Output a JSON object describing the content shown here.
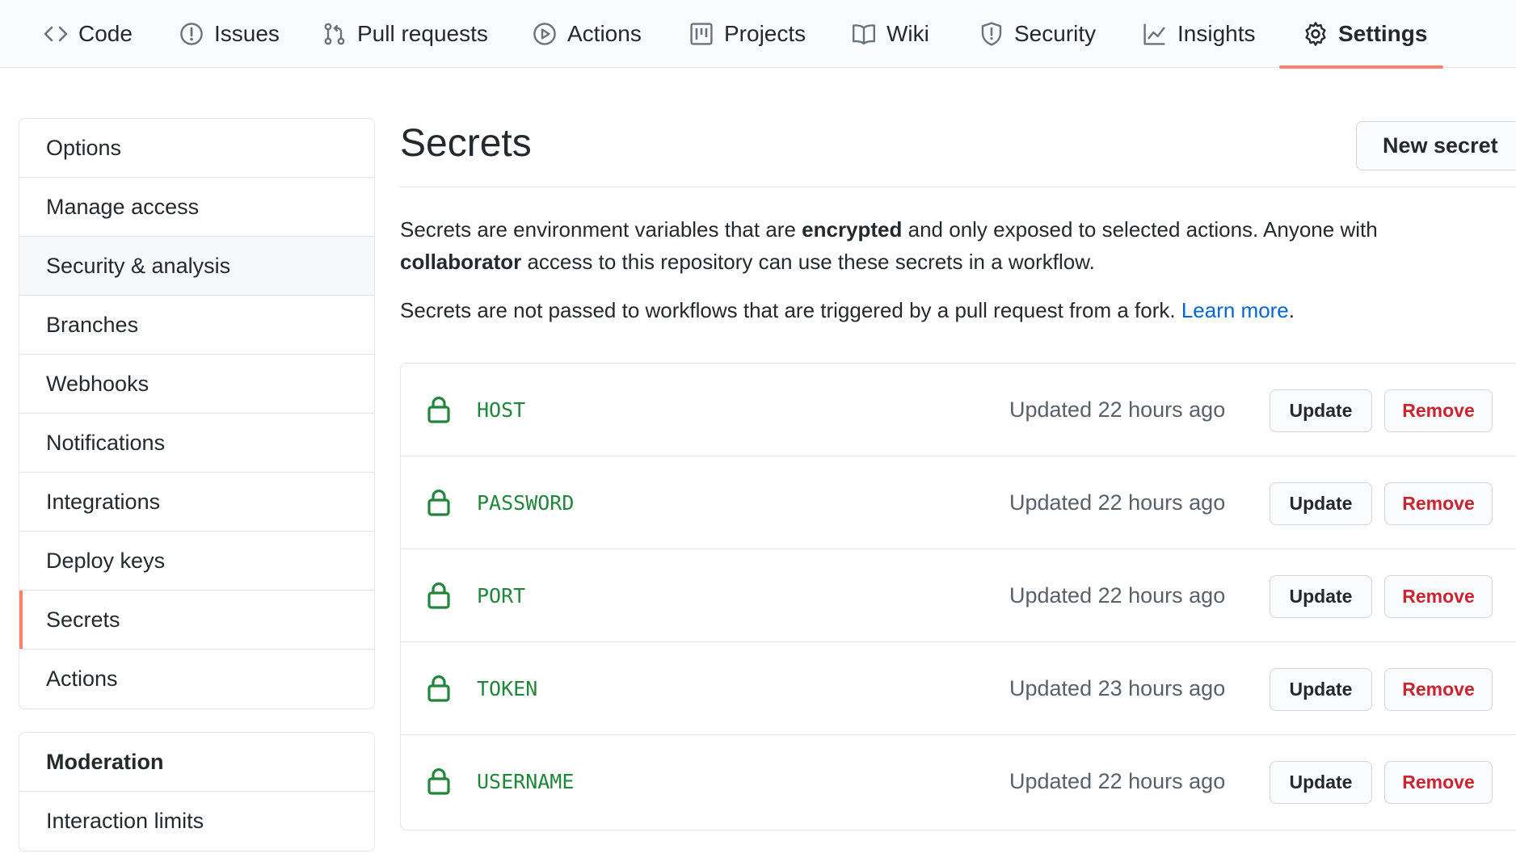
{
  "nav": {
    "tabs": [
      {
        "label": "Code",
        "icon": "code-icon"
      },
      {
        "label": "Issues",
        "icon": "issue-icon"
      },
      {
        "label": "Pull requests",
        "icon": "pull-request-icon"
      },
      {
        "label": "Actions",
        "icon": "play-icon"
      },
      {
        "label": "Projects",
        "icon": "project-icon"
      },
      {
        "label": "Wiki",
        "icon": "book-icon"
      },
      {
        "label": "Security",
        "icon": "shield-icon"
      },
      {
        "label": "Insights",
        "icon": "graph-icon"
      },
      {
        "label": "Settings",
        "icon": "gear-icon",
        "selected": true
      }
    ]
  },
  "sidebar": {
    "items": [
      {
        "label": "Options"
      },
      {
        "label": "Manage access"
      },
      {
        "label": "Security & analysis"
      },
      {
        "label": "Branches"
      },
      {
        "label": "Webhooks"
      },
      {
        "label": "Notifications"
      },
      {
        "label": "Integrations"
      },
      {
        "label": "Deploy keys"
      },
      {
        "label": "Secrets",
        "selected": true
      },
      {
        "label": "Actions"
      }
    ],
    "moderation": {
      "heading": "Moderation",
      "items": [
        {
          "label": "Interaction limits"
        }
      ]
    }
  },
  "main": {
    "title": "Secrets",
    "new_button": "New secret",
    "desc1": {
      "t1": "Secrets are environment variables that are ",
      "b1": "encrypted",
      "t2": " and only exposed to selected actions. Anyone with",
      "b2": "collaborator",
      "t3": " access to this repository can use these secrets in a workflow."
    },
    "desc2": {
      "t1": "Secrets are not passed to workflows that are triggered by a pull request from a fork. ",
      "link": "Learn more",
      "t2": "."
    },
    "secrets": [
      {
        "name": "HOST",
        "updated": "Updated 22 hours ago"
      },
      {
        "name": "PASSWORD",
        "updated": "Updated 22 hours ago"
      },
      {
        "name": "PORT",
        "updated": "Updated 22 hours ago"
      },
      {
        "name": "TOKEN",
        "updated": "Updated 23 hours ago"
      },
      {
        "name": "USERNAME",
        "updated": "Updated 22 hours ago"
      }
    ],
    "update_label": "Update",
    "remove_label": "Remove"
  },
  "colors": {
    "accent": "#f9826c",
    "secret_name": "#22863a",
    "danger": "#cb2431",
    "link": "#0366d6",
    "muted": "#586069"
  }
}
